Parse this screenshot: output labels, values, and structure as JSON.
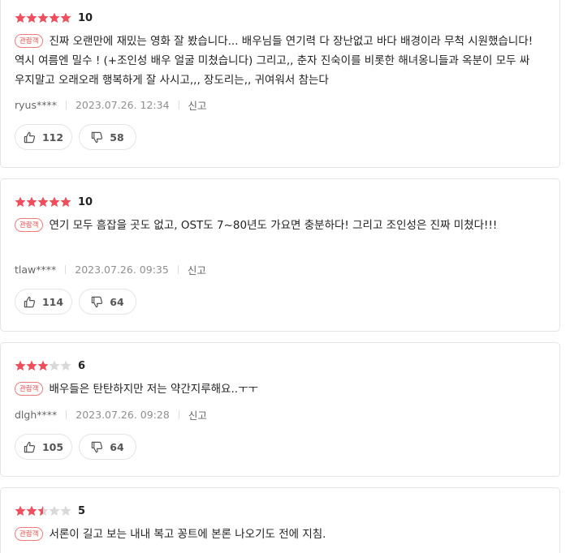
{
  "theme": {
    "star_fill": "#ef4f5c",
    "star_empty": "#d9d9d9",
    "badge_color": "#e94a4a"
  },
  "reviews": [
    {
      "stars": 5,
      "score": "10",
      "badge": "관람객",
      "text": "진짜 오랜만에 재밌는 영화 잘 봤습니다... 배우님들 연기력 다 장난없고 바다 배경이라 무척 시원했습니다! 역시 여름엔 밀수 ! (+조인성 배우 얼굴 미쳤습니다) 그리고,, 춘자 진숙이를 비롯한 해녀옹니들과 옥분이 모두 싸우지말고 오래오래 행복하게 잘 사시고,,, 장도리는,, 귀여워서 참는다",
      "author": "ryus****",
      "date": "2023.07.26. 12:34",
      "report": "신고",
      "likes": "112",
      "dislikes": "58"
    },
    {
      "stars": 5,
      "score": "10",
      "badge": "관람객",
      "text": "연기 모두 흠잡을 곳도 없고, OST도 7~80년도 가요면 충분하다! 그리고 조인성은 진짜 미쳤다!!!",
      "author": "tlaw****",
      "date": "2023.07.26. 09:35",
      "report": "신고",
      "likes": "114",
      "dislikes": "64"
    },
    {
      "stars": 3,
      "score": "6",
      "badge": "관람객",
      "text": "배우들은 탄탄하지만 저는 약간지루해요..ㅜㅜ",
      "author": "dlgh****",
      "date": "2023.07.26. 09:28",
      "report": "신고",
      "likes": "105",
      "dislikes": "64"
    },
    {
      "stars": 2.5,
      "score": "5",
      "badge": "관람객",
      "text": "서론이 길고 보는 내내 복고 꽁트에 본론 나오기도 전에 지침.",
      "author": "",
      "date": "",
      "report": "",
      "likes": "",
      "dislikes": ""
    }
  ]
}
